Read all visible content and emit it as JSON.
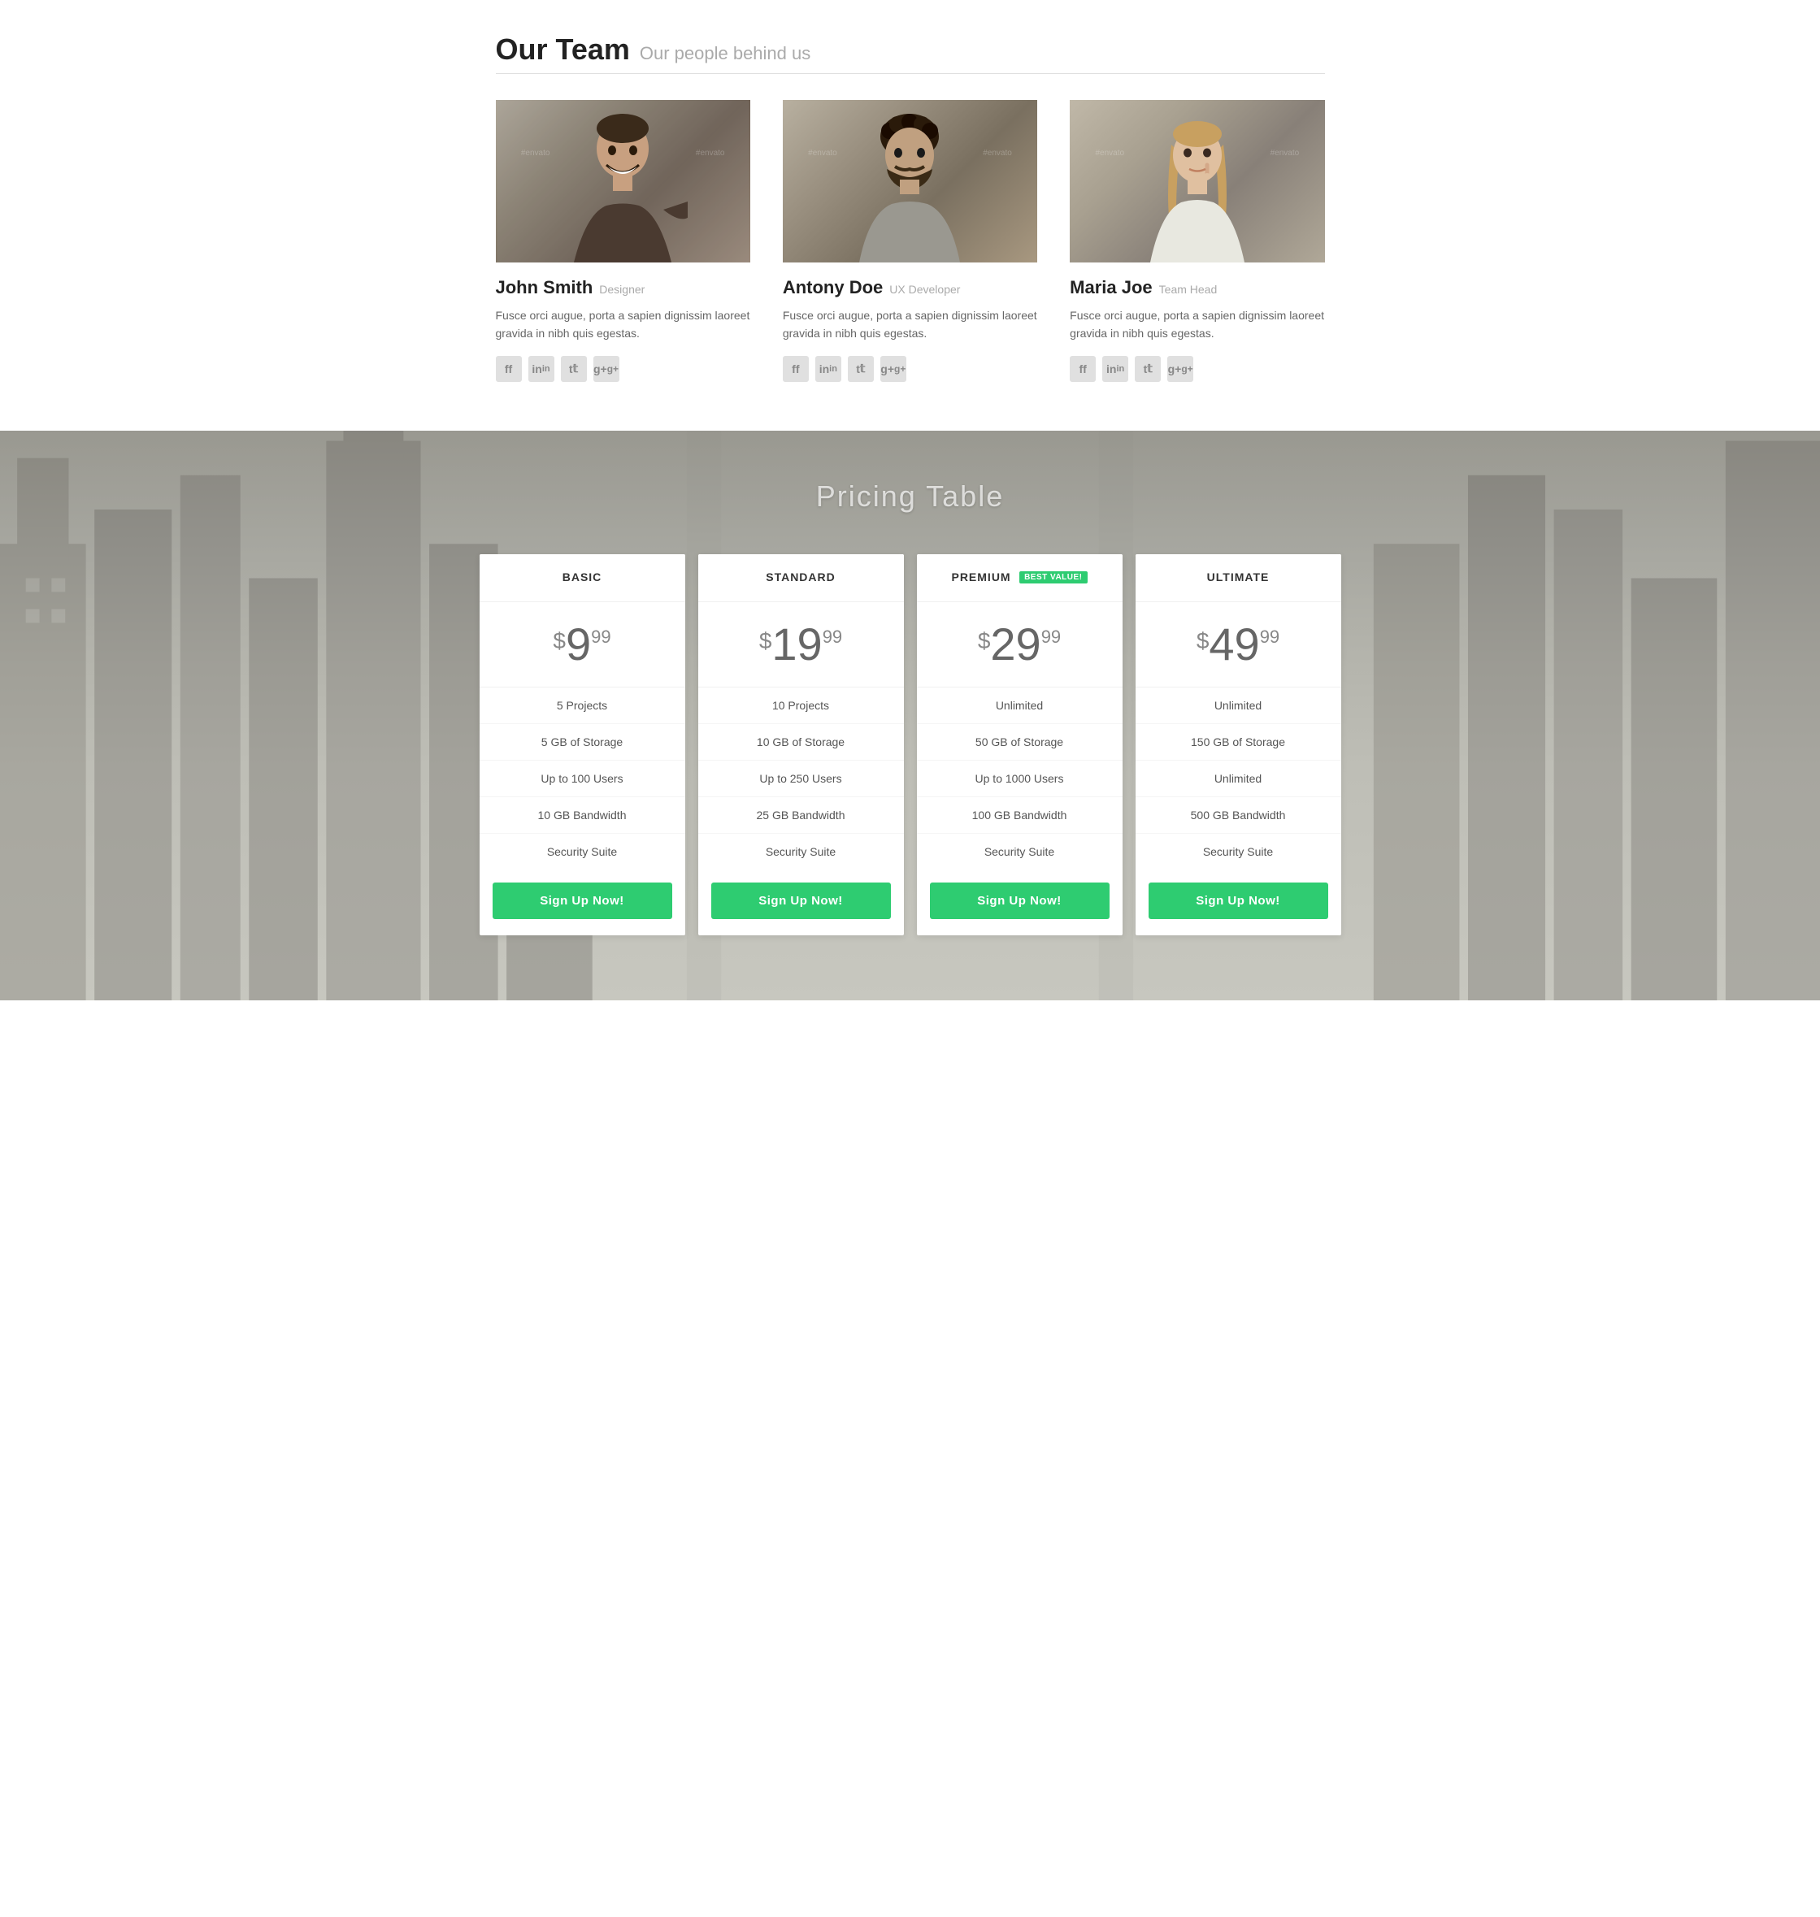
{
  "team": {
    "section_title": "Our Team",
    "section_subtitle": "Our people behind us",
    "members": [
      {
        "name": "John Smith",
        "title": "Designer",
        "bio": "Fusce orci augue, porta a sapien dignissim laoreet gravida in nibh quis egestas.",
        "photo_class": "photo-john",
        "social": [
          "f",
          "in",
          "t",
          "g+"
        ]
      },
      {
        "name": "Antony Doe",
        "title": "UX Developer",
        "bio": "Fusce orci augue, porta a sapien dignissim laoreet gravida in nibh quis egestas.",
        "photo_class": "photo-antony",
        "social": [
          "f",
          "in",
          "t",
          "g+"
        ]
      },
      {
        "name": "Maria Joe",
        "title": "Team Head",
        "bio": "Fusce orci augue, porta a sapien dignissim laoreet gravida in nibh quis egestas.",
        "photo_class": "photo-maria",
        "social": [
          "f",
          "in",
          "t",
          "g+"
        ]
      }
    ]
  },
  "pricing": {
    "section_title": "Pricing Table",
    "plans": [
      {
        "name": "BASIC",
        "badge": null,
        "price_dollar": "$",
        "price_main": "9",
        "price_cents": "99",
        "features": [
          "5 Projects",
          "5 GB of Storage",
          "Up to 100 Users",
          "10 GB Bandwidth",
          "Security Suite"
        ],
        "button_label": "Sign Up Now!"
      },
      {
        "name": "STANDARD",
        "badge": null,
        "price_dollar": "$",
        "price_main": "19",
        "price_cents": "99",
        "features": [
          "10 Projects",
          "10 GB of Storage",
          "Up to 250 Users",
          "25 GB Bandwidth",
          "Security Suite"
        ],
        "button_label": "Sign Up Now!"
      },
      {
        "name": "PREMIUM",
        "badge": "BEST VALUE!",
        "price_dollar": "$",
        "price_main": "29",
        "price_cents": "99",
        "features": [
          "Unlimited",
          "50 GB of Storage",
          "Up to 1000 Users",
          "100 GB Bandwidth",
          "Security Suite"
        ],
        "button_label": "Sign Up Now!"
      },
      {
        "name": "ULTIMATE",
        "badge": null,
        "price_dollar": "$",
        "price_main": "49",
        "price_cents": "99",
        "features": [
          "Unlimited",
          "150 GB of Storage",
          "Unlimited",
          "500 GB Bandwidth",
          "Security Suite"
        ],
        "button_label": "Sign Up Now!"
      }
    ]
  },
  "social_labels": {
    "facebook": "f",
    "linkedin": "in",
    "twitter": "t",
    "googleplus": "g+"
  }
}
